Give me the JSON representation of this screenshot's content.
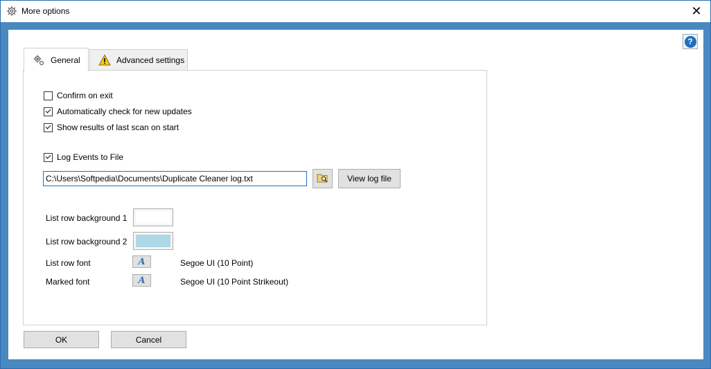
{
  "window": {
    "title": "More options",
    "close_glyph": "✕"
  },
  "help": {
    "glyph": "?"
  },
  "tabs": [
    {
      "label": "General",
      "icon": "gear-icon",
      "selected": true
    },
    {
      "label": "Advanced settings",
      "icon": "warning-icon",
      "selected": false
    }
  ],
  "general": {
    "confirm_exit": {
      "label": "Confirm on exit",
      "checked": false
    },
    "auto_updates": {
      "label": "Automatically check for new updates",
      "checked": true
    },
    "show_results": {
      "label": "Show results of last scan on start",
      "checked": true
    },
    "log_events": {
      "label": "Log Events to File",
      "checked": true
    },
    "log_path": "C:\\Users\\Softpedia\\Documents\\Duplicate Cleaner log.txt",
    "view_log_label": "View log file",
    "row_bg1": {
      "label": "List row background 1",
      "color": "#ffffff"
    },
    "row_bg2": {
      "label": "List row background 2",
      "color": "#add8e6"
    },
    "row_font": {
      "label": "List row font",
      "value": "Segoe UI (10 Point)",
      "glyph": "A"
    },
    "marked_font": {
      "label": "Marked font",
      "value": "Segoe UI (10 Point Strikeout)",
      "glyph": "A"
    }
  },
  "buttons": {
    "ok": "OK",
    "cancel": "Cancel"
  }
}
